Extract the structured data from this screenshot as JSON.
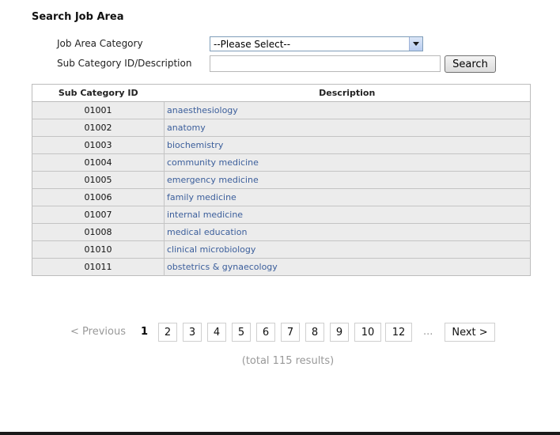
{
  "page": {
    "title": "Search Job Area"
  },
  "form": {
    "category_label": "Job Area Category",
    "category_value": "--Please Select--",
    "sub_label": "Sub Category ID/Description",
    "sub_value": "",
    "search_label": "Search"
  },
  "table": {
    "headers": [
      "Sub Category ID",
      "Description"
    ],
    "rows": [
      {
        "id": "01001",
        "desc": "anaesthesiology"
      },
      {
        "id": "01002",
        "desc": "anatomy"
      },
      {
        "id": "01003",
        "desc": "biochemistry"
      },
      {
        "id": "01004",
        "desc": "community medicine"
      },
      {
        "id": "01005",
        "desc": "emergency medicine"
      },
      {
        "id": "01006",
        "desc": "family medicine"
      },
      {
        "id": "01007",
        "desc": "internal medicine"
      },
      {
        "id": "01008",
        "desc": "medical education"
      },
      {
        "id": "01010",
        "desc": "clinical microbiology"
      },
      {
        "id": "01011",
        "desc": "obstetrics & gynaecology"
      }
    ]
  },
  "pagination": {
    "prev_label": "< Previous",
    "current": "1",
    "pages": [
      "2",
      "3",
      "4",
      "5",
      "6",
      "7",
      "8",
      "9",
      "10",
      "12"
    ],
    "ellipsis": "...",
    "next_label": "Next >",
    "total": "(total 115 results)"
  },
  "icons": {
    "select_arrow": "dropdown-arrow-icon"
  },
  "colors": {
    "link": "#3b5e9b",
    "row_bg": "#ececec",
    "muted": "#999999"
  }
}
